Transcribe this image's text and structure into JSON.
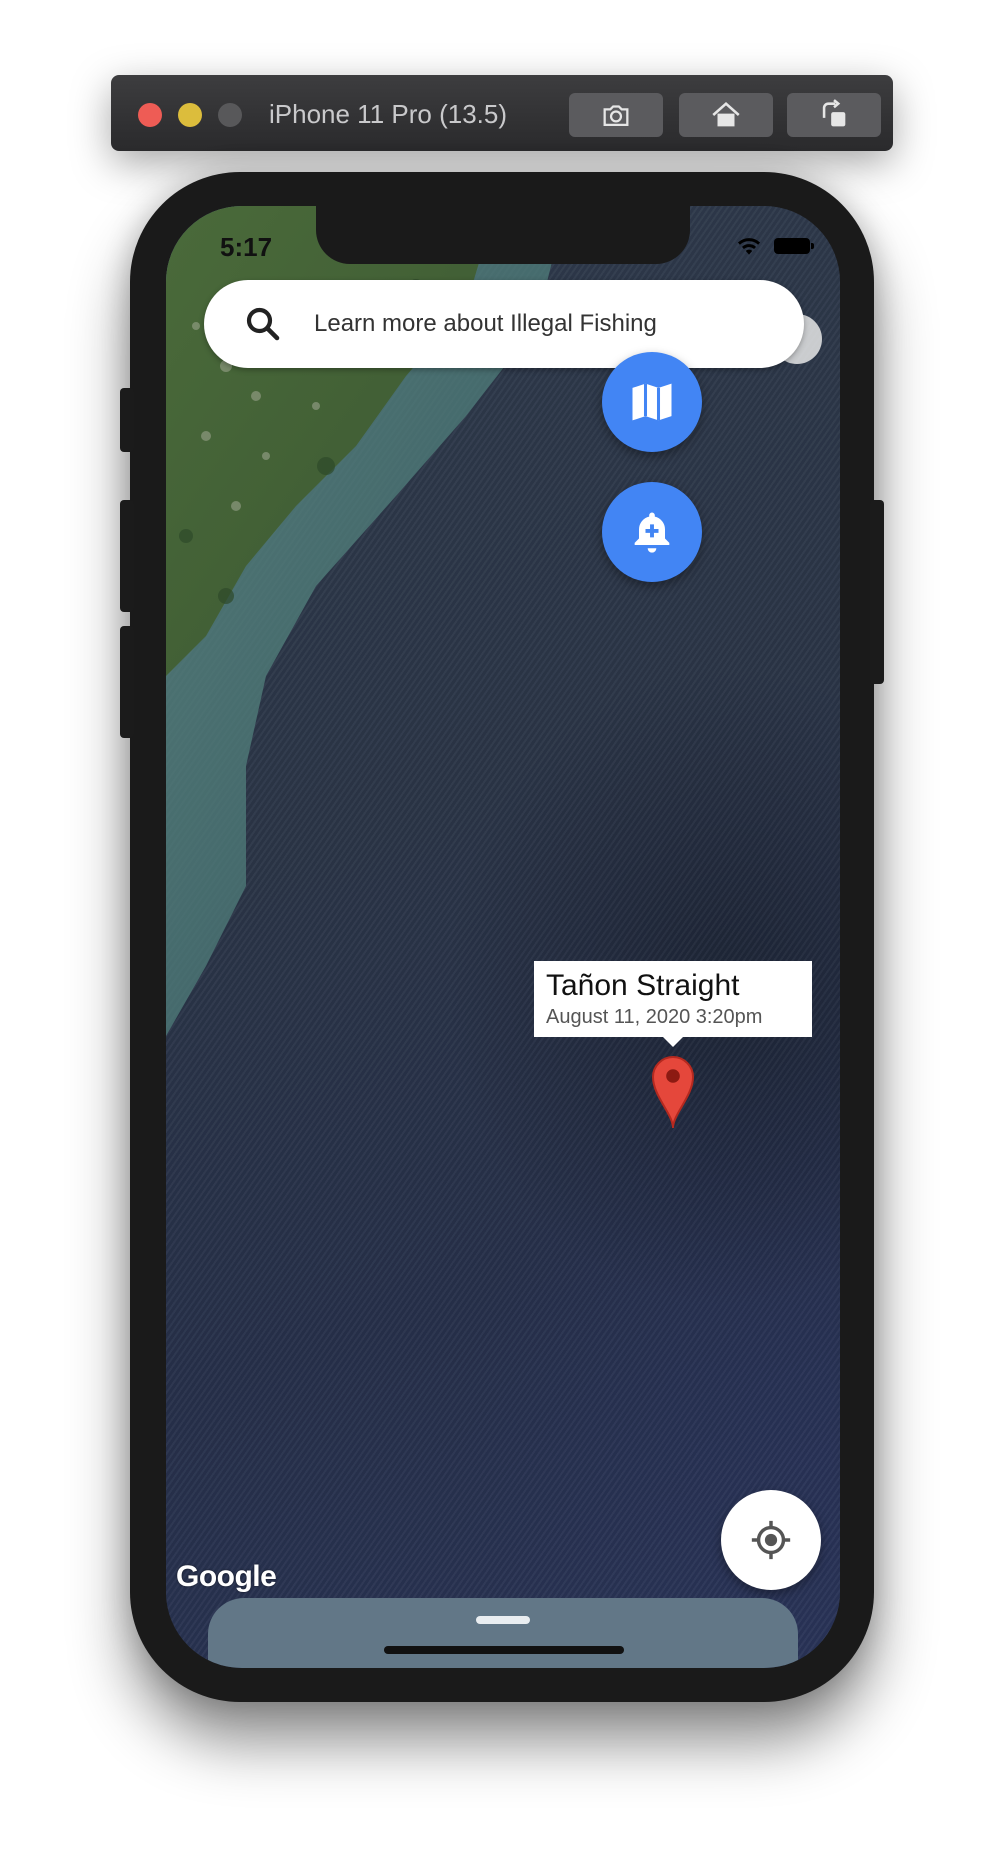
{
  "simulator": {
    "title": "iPhone 11 Pro (13.5)",
    "buttons": [
      "screenshot-icon",
      "home-icon",
      "rotate-icon"
    ]
  },
  "status_bar": {
    "time": "5:17",
    "icons": [
      "wifi-icon",
      "battery-icon"
    ]
  },
  "search": {
    "placeholder": "Learn more about Illegal Fishing",
    "icon": "search-icon"
  },
  "fabs": {
    "map_type_icon": "map-icon",
    "report_icon": "add-alert-icon",
    "accent": "#4285f4"
  },
  "map": {
    "attribution": "Google",
    "marker": {
      "title": "Tañon Straight",
      "subtitle": "August 11, 2020 3:20pm",
      "color": "#e5473b"
    }
  },
  "locate": {
    "icon": "my-location-icon"
  },
  "bottom_sheet": {
    "color": "#627787"
  }
}
